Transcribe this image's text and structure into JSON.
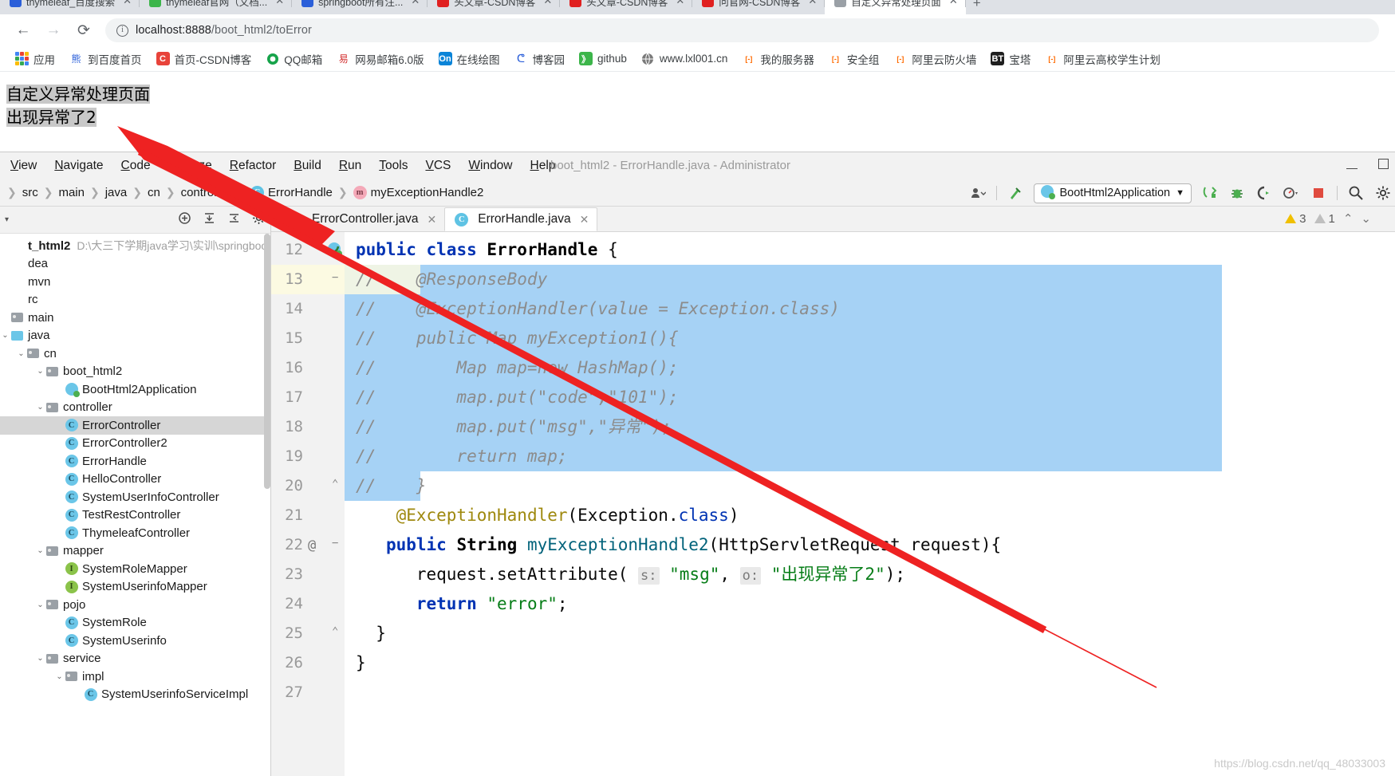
{
  "browser": {
    "tabs": [
      {
        "label": "thymeleaf_百度搜索",
        "favicon_color": "#2b5fd9"
      },
      {
        "label": "thymeleaf官网（文档...",
        "favicon_color": "#3cb54a"
      },
      {
        "label": "springboot所有注...",
        "favicon_color": "#2b5fd9"
      },
      {
        "label": "头文章-CSDN博客",
        "favicon_color": "#e02020"
      },
      {
        "label": "头文章-CSDN博客",
        "favicon_color": "#e02020"
      },
      {
        "label": "问官网-CSDN博客",
        "favicon_color": "#e02020"
      },
      {
        "label": "自定义异常处理页面",
        "favicon_color": "#9aa0a6"
      }
    ],
    "new_tab_label": "+",
    "nav": {
      "back": "←",
      "forward": "→",
      "reload": "⟳",
      "url_host": "localhost:8888",
      "url_path": "/boot_html2/toError",
      "info_icon": "ⓘ"
    },
    "bookmarks": [
      {
        "label": "应用",
        "icon": "apps-grid-icon",
        "icon_text": "",
        "bg": "transparent",
        "fg": "#4285f4"
      },
      {
        "label": "到百度首页",
        "icon": "baidu-icon",
        "icon_text": "百",
        "bg": "transparent",
        "fg": "#2b5fd9"
      },
      {
        "label": "首页-CSDN博客",
        "icon": "csdn-icon",
        "icon_text": "C",
        "bg": "#e8433a",
        "fg": "#ffffff"
      },
      {
        "label": "QQ邮箱",
        "icon": "qqmail-icon",
        "icon_text": "",
        "bg": "transparent",
        "fg": "#16a34a"
      },
      {
        "label": "网易邮箱6.0版",
        "icon": "netease-mail-icon",
        "icon_text": "易",
        "bg": "transparent",
        "fg": "#d32f2f"
      },
      {
        "label": "在线绘图",
        "icon": "online-draw-icon",
        "icon_text": "On",
        "bg": "#0a84d8",
        "fg": "#ffffff"
      },
      {
        "label": "博客园",
        "icon": "cnblogs-icon",
        "icon_text": "",
        "bg": "transparent",
        "fg": "#2b5fd9"
      },
      {
        "label": "github",
        "icon": "github-icon",
        "icon_text": "》",
        "bg": "#3cb54a",
        "fg": "#ffffff"
      },
      {
        "label": "www.lxl001.cn",
        "icon": "globe-icon",
        "icon_text": "",
        "bg": "transparent",
        "fg": "#6b6b6b"
      },
      {
        "label": "我的服务器",
        "icon": "aliyun-icon",
        "icon_text": "[-]",
        "bg": "transparent",
        "fg": "#ff6a00"
      },
      {
        "label": "安全组",
        "icon": "aliyun-icon",
        "icon_text": "[-]",
        "bg": "transparent",
        "fg": "#ff6a00"
      },
      {
        "label": "阿里云防火墙",
        "icon": "aliyun-icon",
        "icon_text": "[-]",
        "bg": "transparent",
        "fg": "#ff6a00"
      },
      {
        "label": "宝塔",
        "icon": "bt-panel-icon",
        "icon_text": "BT",
        "bg": "#1f1f1f",
        "fg": "#ffffff"
      },
      {
        "label": "阿里云高校学生计划",
        "icon": "aliyun-icon",
        "icon_text": "[-]",
        "bg": "transparent",
        "fg": "#ff6a00"
      }
    ]
  },
  "page": {
    "line1": "自定义异常处理页面",
    "line2": "出现异常了2"
  },
  "idea": {
    "title": "boot_html2 - ErrorHandle.java - Administrator",
    "menu": [
      "View",
      "Navigate",
      "Code",
      "Analyze",
      "Refactor",
      "Build",
      "Run",
      "Tools",
      "VCS",
      "Window",
      "Help"
    ],
    "menu_first_partial": "",
    "window_controls": {
      "minimize": "minimize-icon",
      "maximize": "maximize-icon"
    },
    "breadcrumb": [
      {
        "label": "src",
        "badge": ""
      },
      {
        "label": "main",
        "badge": ""
      },
      {
        "label": "java",
        "badge": ""
      },
      {
        "label": "cn",
        "badge": ""
      },
      {
        "label": "controller",
        "badge": ""
      },
      {
        "label": "ErrorHandle",
        "badge": "C"
      },
      {
        "label": "myExceptionHandle2",
        "badge": "m"
      }
    ],
    "toolbar": {
      "run_config": "BootHtml2Application",
      "dropdown_caret": "▼",
      "icons": [
        "user-icon",
        "hammer-build-icon",
        "run-icon",
        "debug-icon",
        "run-with-coverage-icon",
        "profile-icon",
        "stop-icon",
        "search-everywhere-icon",
        "settings-gear-icon"
      ]
    },
    "project_panel": {
      "header_title": "",
      "root_name": "t_html2",
      "root_path": "D:\\大三下学期java学习\\实训\\springboot\\boot",
      "tree": [
        {
          "indent": 0,
          "arrow": "",
          "icon": "root",
          "label": "t_html2",
          "path": "D:\\大三下学期java学习\\实训\\springboot\\boot",
          "bold": true,
          "selected": false
        },
        {
          "indent": 0,
          "arrow": "",
          "icon": "none",
          "label": "dea",
          "path": "",
          "bold": false,
          "selected": false
        },
        {
          "indent": 0,
          "arrow": "",
          "icon": "none",
          "label": "mvn",
          "path": "",
          "bold": false,
          "selected": false
        },
        {
          "indent": 0,
          "arrow": "",
          "icon": "none",
          "label": "rc",
          "path": "",
          "bold": false,
          "selected": false
        },
        {
          "indent": 0,
          "arrow": "",
          "icon": "folder-gray",
          "label": "main",
          "path": "",
          "bold": false,
          "selected": false
        },
        {
          "indent": 0,
          "arrow": "⌄",
          "icon": "folder-blue",
          "label": "java",
          "path": "",
          "bold": false,
          "selected": false
        },
        {
          "indent": 1,
          "arrow": "⌄",
          "icon": "folder-gray",
          "label": "cn",
          "path": "",
          "bold": false,
          "selected": false
        },
        {
          "indent": 2,
          "arrow": "⌄",
          "icon": "folder-gray",
          "label": "boot_html2",
          "path": "",
          "bold": false,
          "selected": false
        },
        {
          "indent": 3,
          "arrow": "",
          "icon": "spring",
          "label": "BootHtml2Application",
          "path": "",
          "bold": false,
          "selected": false
        },
        {
          "indent": 2,
          "arrow": "⌄",
          "icon": "folder-gray",
          "label": "controller",
          "path": "",
          "bold": false,
          "selected": false
        },
        {
          "indent": 3,
          "arrow": "",
          "icon": "class",
          "label": "ErrorController",
          "path": "",
          "bold": false,
          "selected": true
        },
        {
          "indent": 3,
          "arrow": "",
          "icon": "class",
          "label": "ErrorController2",
          "path": "",
          "bold": false,
          "selected": false
        },
        {
          "indent": 3,
          "arrow": "",
          "icon": "class",
          "label": "ErrorHandle",
          "path": "",
          "bold": false,
          "selected": false
        },
        {
          "indent": 3,
          "arrow": "",
          "icon": "class",
          "label": "HelloController",
          "path": "",
          "bold": false,
          "selected": false
        },
        {
          "indent": 3,
          "arrow": "",
          "icon": "class",
          "label": "SystemUserInfoController",
          "path": "",
          "bold": false,
          "selected": false
        },
        {
          "indent": 3,
          "arrow": "",
          "icon": "class",
          "label": "TestRestController",
          "path": "",
          "bold": false,
          "selected": false
        },
        {
          "indent": 3,
          "arrow": "",
          "icon": "class",
          "label": "ThymeleafController",
          "path": "",
          "bold": false,
          "selected": false
        },
        {
          "indent": 2,
          "arrow": "⌄",
          "icon": "folder-gray",
          "label": "mapper",
          "path": "",
          "bold": false,
          "selected": false
        },
        {
          "indent": 3,
          "arrow": "",
          "icon": "interface",
          "label": "SystemRoleMapper",
          "path": "",
          "bold": false,
          "selected": false
        },
        {
          "indent": 3,
          "arrow": "",
          "icon": "interface",
          "label": "SystemUserinfoMapper",
          "path": "",
          "bold": false,
          "selected": false
        },
        {
          "indent": 2,
          "arrow": "⌄",
          "icon": "folder-gray",
          "label": "pojo",
          "path": "",
          "bold": false,
          "selected": false
        },
        {
          "indent": 3,
          "arrow": "",
          "icon": "class",
          "label": "SystemRole",
          "path": "",
          "bold": false,
          "selected": false
        },
        {
          "indent": 3,
          "arrow": "",
          "icon": "class",
          "label": "SystemUserinfo",
          "path": "",
          "bold": false,
          "selected": false
        },
        {
          "indent": 2,
          "arrow": "⌄",
          "icon": "folder-gray",
          "label": "service",
          "path": "",
          "bold": false,
          "selected": false
        },
        {
          "indent": 3,
          "arrow": "⌄",
          "icon": "folder-gray",
          "label": "impl",
          "path": "",
          "bold": false,
          "selected": false
        },
        {
          "indent": 4,
          "arrow": "",
          "icon": "class",
          "label": "SystemUserinfoServiceImpl",
          "path": "",
          "bold": false,
          "selected": false
        }
      ]
    },
    "editor": {
      "tabs": [
        {
          "label": "ErrorController.java",
          "active": false,
          "badge": "C"
        },
        {
          "label": "ErrorHandle.java",
          "active": true,
          "badge": "C"
        }
      ],
      "inspections": {
        "warnings": "3",
        "weak_warnings": "1"
      },
      "lines": [
        {
          "no": "12",
          "mark": "",
          "selected": false,
          "current": false
        },
        {
          "no": "13",
          "mark": "",
          "selected": true,
          "current": true
        },
        {
          "no": "14",
          "mark": "",
          "selected": true,
          "current": false
        },
        {
          "no": "15",
          "mark": "",
          "selected": true,
          "current": false
        },
        {
          "no": "16",
          "mark": "",
          "selected": true,
          "current": false
        },
        {
          "no": "17",
          "mark": "",
          "selected": true,
          "current": false
        },
        {
          "no": "18",
          "mark": "",
          "selected": true,
          "current": false
        },
        {
          "no": "19",
          "mark": "",
          "selected": true,
          "current": false
        },
        {
          "no": "20",
          "mark": "",
          "selected": true,
          "current": false
        },
        {
          "no": "21",
          "mark": "",
          "selected": false,
          "current": false
        },
        {
          "no": "22",
          "mark": "@",
          "selected": false,
          "current": false
        },
        {
          "no": "23",
          "mark": "",
          "selected": false,
          "current": false
        },
        {
          "no": "24",
          "mark": "",
          "selected": false,
          "current": false
        },
        {
          "no": "25",
          "mark": "",
          "selected": false,
          "current": false
        },
        {
          "no": "26",
          "mark": "",
          "selected": false,
          "current": false
        },
        {
          "no": "27",
          "mark": "",
          "selected": false,
          "current": false
        }
      ],
      "code_text": [
        "public class ErrorHandle {",
        "//    @ResponseBody",
        "//    @ExceptionHandler(value = Exception.class)",
        "//    public Map myException1(){",
        "//        Map map=new HashMap();",
        "//        map.put(\"code\",\"101\");",
        "//        map.put(\"msg\",\"异常\");",
        "//        return map;",
        "//    }",
        "    @ExceptionHandler(Exception.class)",
        "    public String myExceptionHandle2(HttpServletRequest request){",
        "        request.setAttribute( s: \"msg\", o: \"出现异常了2\");",
        "        return \"error\";",
        "    }",
        "}",
        ""
      ],
      "param_hints": {
        "s": "s:",
        "o": "o:"
      }
    },
    "watermark": "https://blog.csdn.net/qq_48033003"
  },
  "annotation": {
    "arrow_color": "#ee2222",
    "description": "red-arrow-annotation"
  }
}
